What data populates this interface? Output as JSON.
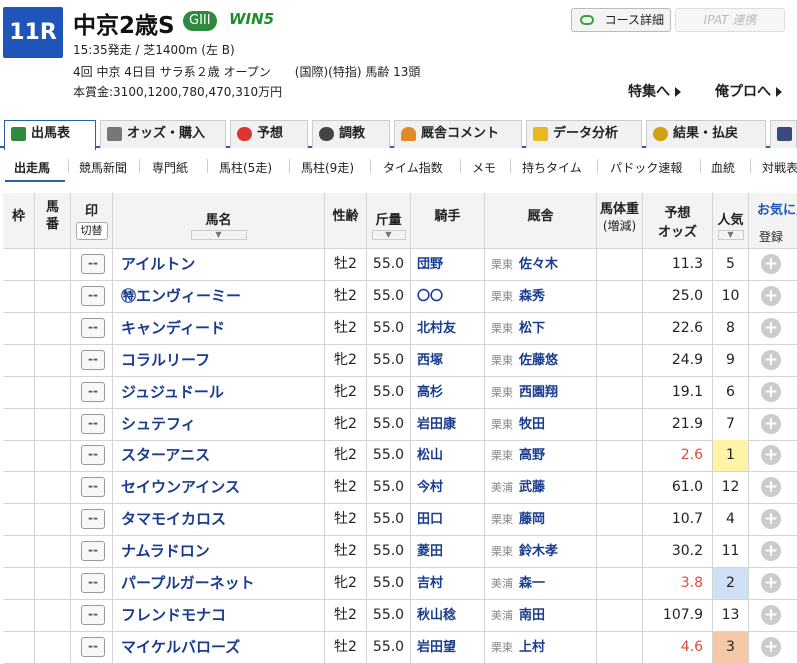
{
  "race": {
    "number": "11R",
    "title": "中京2歳S",
    "grade": "GIII",
    "win5": "WIN5",
    "info1": "15:35発走 / 芝1400m (左 B)",
    "info2": "4回 中京 4日目 サラ系２歳 オープン　　(国際)(特指) 馬齢 13頭",
    "info3": "本賞金:3100,1200,780,470,310万円"
  },
  "header": {
    "course_btn": "コース詳細",
    "ipat_btn": "IPAT 連携",
    "tokushu": "特集へ",
    "orepro": "俺プロへ"
  },
  "tabs": [
    "出馬表",
    "オッズ・購入",
    "予想",
    "調教",
    "厩舎コメント",
    "データ分析",
    "結果・払戻"
  ],
  "subnav": [
    "出走馬",
    "競馬新聞",
    "専門紙",
    "馬柱(5走)",
    "馬柱(9走)",
    "タイム指数",
    "メモ",
    "持ちタイム",
    "パドック速報",
    "血統",
    "対戦表"
  ],
  "columns": {
    "waku": "枠",
    "umaban": "馬番",
    "mark": "印",
    "mark_toggle": "切替",
    "name": "馬名",
    "age": "性齢",
    "weight": "斤量",
    "jockey": "騎手",
    "stable": "厩舎",
    "body": "馬体重",
    "body_sub": "(増減)",
    "odds_l1": "予想",
    "odds_l2": "オッズ",
    "pop": "人気",
    "fav_l1": "お気に入",
    "fav_l2": "登録"
  },
  "mark_placeholder": "--",
  "horses": [
    {
      "name": "アイルトン",
      "age": "牡2",
      "weight": "55.0",
      "jockey": "団野",
      "region": "栗東",
      "trainer": "佐々木",
      "odds": "11.3",
      "pop": "5"
    },
    {
      "name": "㊕エンヴィーミー",
      "age": "牡2",
      "weight": "55.0",
      "jockey": "〇〇",
      "region": "栗東",
      "trainer": "森秀",
      "odds": "25.0",
      "pop": "10"
    },
    {
      "name": "キャンディード",
      "age": "牡2",
      "weight": "55.0",
      "jockey": "北村友",
      "region": "栗東",
      "trainer": "松下",
      "odds": "22.6",
      "pop": "8"
    },
    {
      "name": "コラルリーフ",
      "age": "牝2",
      "weight": "55.0",
      "jockey": "西塚",
      "region": "栗東",
      "trainer": "佐藤悠",
      "odds": "24.9",
      "pop": "9"
    },
    {
      "name": "ジュジュドール",
      "age": "牝2",
      "weight": "55.0",
      "jockey": "高杉",
      "region": "栗東",
      "trainer": "西園翔",
      "odds": "19.1",
      "pop": "6"
    },
    {
      "name": "シュテフィ",
      "age": "牝2",
      "weight": "55.0",
      "jockey": "岩田康",
      "region": "栗東",
      "trainer": "牧田",
      "odds": "21.9",
      "pop": "7"
    },
    {
      "name": "スターアニス",
      "age": "牝2",
      "weight": "55.0",
      "jockey": "松山",
      "region": "栗東",
      "trainer": "高野",
      "odds": "2.6",
      "pop": "1"
    },
    {
      "name": "セイウンアインス",
      "age": "牡2",
      "weight": "55.0",
      "jockey": "今村",
      "region": "美浦",
      "trainer": "武藤",
      "odds": "61.0",
      "pop": "12"
    },
    {
      "name": "タマモイカロス",
      "age": "牡2",
      "weight": "55.0",
      "jockey": "田口",
      "region": "栗東",
      "trainer": "藤岡",
      "odds": "10.7",
      "pop": "4"
    },
    {
      "name": "ナムラドロン",
      "age": "牡2",
      "weight": "55.0",
      "jockey": "菱田",
      "region": "栗東",
      "trainer": "鈴木孝",
      "odds": "30.2",
      "pop": "11"
    },
    {
      "name": "パープルガーネット",
      "age": "牝2",
      "weight": "55.0",
      "jockey": "吉村",
      "region": "美浦",
      "trainer": "森一",
      "odds": "3.8",
      "pop": "2"
    },
    {
      "name": "フレンドモナコ",
      "age": "牡2",
      "weight": "55.0",
      "jockey": "秋山稔",
      "region": "美浦",
      "trainer": "南田",
      "odds": "107.9",
      "pop": "13"
    },
    {
      "name": "マイケルバローズ",
      "age": "牡2",
      "weight": "55.0",
      "jockey": "岩田望",
      "region": "栗東",
      "trainer": "上村",
      "odds": "4.6",
      "pop": "3"
    }
  ],
  "colors": {
    "race_badge": "#1f54b8",
    "grade": "#2e8b3e",
    "horse_name": "#1a3c8f",
    "top_odds": "#d94f3d",
    "pop1": "#fff3a6",
    "pop2": "#cfe0f6",
    "pop3": "#f5c9a8"
  }
}
